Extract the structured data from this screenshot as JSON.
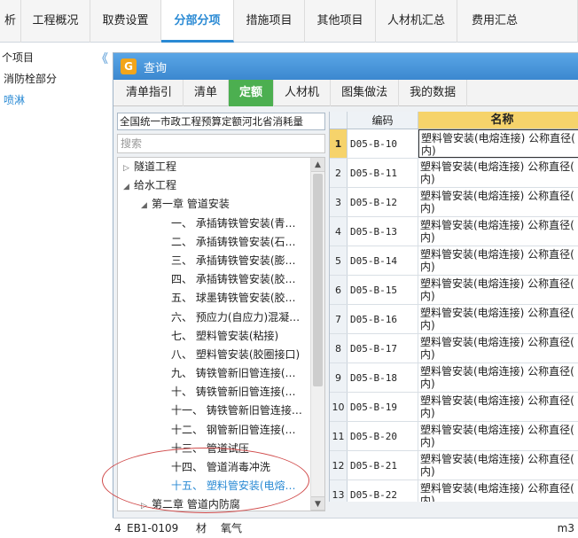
{
  "topbar": {
    "tabs": [
      {
        "label": "析",
        "active": false
      },
      {
        "label": "工程概况",
        "active": false
      },
      {
        "label": "取费设置",
        "active": false
      },
      {
        "label": "分部分项",
        "active": true
      },
      {
        "label": "措施项目",
        "active": false
      },
      {
        "label": "其他项目",
        "active": false
      },
      {
        "label": "人材机汇总",
        "active": false
      },
      {
        "label": "费用汇总",
        "active": false
      }
    ]
  },
  "left_panel": {
    "rows": [
      "个项目",
      "消防栓部分",
      "喷淋"
    ],
    "collapse_icon": "double-chevron-left"
  },
  "dialog": {
    "title": "查询",
    "tabs": [
      "清单指引",
      "清单",
      "定额",
      "人材机",
      "图集做法",
      "我的数据"
    ],
    "active_tab": "定额",
    "db_select": "全国统一市政工程预算定额河北省消耗量",
    "search_placeholder": "搜索",
    "tree": [
      {
        "label": "隧道工程",
        "level": 0,
        "arrow": "▷"
      },
      {
        "label": "给水工程",
        "level": 0,
        "arrow": "◢"
      },
      {
        "label": "第一章  管道安装",
        "level": 1,
        "arrow": "◢"
      },
      {
        "label": "一、  承插铸铁管安装(青…",
        "level": 2,
        "arrow": ""
      },
      {
        "label": "二、  承插铸铁管安装(石…",
        "level": 2,
        "arrow": ""
      },
      {
        "label": "三、  承插铸铁管安装(膨…",
        "level": 2,
        "arrow": ""
      },
      {
        "label": "四、  承插铸铁管安装(胶…",
        "level": 2,
        "arrow": ""
      },
      {
        "label": "五、  球墨铸铁管安装(胶…",
        "level": 2,
        "arrow": ""
      },
      {
        "label": "六、  预应力(自应力)混凝…",
        "level": 2,
        "arrow": ""
      },
      {
        "label": "七、  塑料管安装(粘接)",
        "level": 2,
        "arrow": ""
      },
      {
        "label": "八、  塑料管安装(胶圈接口)",
        "level": 2,
        "arrow": ""
      },
      {
        "label": "九、  铸铁管新旧管连接(…",
        "level": 2,
        "arrow": ""
      },
      {
        "label": "十、  铸铁管新旧管连接(…",
        "level": 2,
        "arrow": ""
      },
      {
        "label": "十一、  铸铁管新旧管连接…",
        "level": 2,
        "arrow": ""
      },
      {
        "label": "十二、  钢管新旧管连接(…",
        "level": 2,
        "arrow": ""
      },
      {
        "label": "十三、  管道试压",
        "level": 2,
        "arrow": ""
      },
      {
        "label": "十四、  管道消毒冲洗",
        "level": 2,
        "arrow": ""
      },
      {
        "label": "十五、  塑料管安装(电熔…",
        "level": 2,
        "arrow": "",
        "highlight": true
      },
      {
        "label": "第二章  管道内防腐",
        "level": 1,
        "arrow": "▷"
      }
    ],
    "grid": {
      "headers": {
        "code": "编码",
        "name": "名称"
      },
      "rows": [
        {
          "n": "1",
          "code": "D05-B-10",
          "l1": "塑料管安装(电熔连接) 公称直径(",
          "l2": "内)",
          "selected": true
        },
        {
          "n": "2",
          "code": "D05-B-11",
          "l1": "塑料管安装(电熔连接) 公称直径(",
          "l2": "内)"
        },
        {
          "n": "3",
          "code": "D05-B-12",
          "l1": "塑料管安装(电熔连接) 公称直径(",
          "l2": "内)"
        },
        {
          "n": "4",
          "code": "D05-B-13",
          "l1": "塑料管安装(电熔连接) 公称直径(",
          "l2": "内)"
        },
        {
          "n": "5",
          "code": "D05-B-14",
          "l1": "塑料管安装(电熔连接) 公称直径(",
          "l2": "内)"
        },
        {
          "n": "6",
          "code": "D05-B-15",
          "l1": "塑料管安装(电熔连接) 公称直径(",
          "l2": "内)"
        },
        {
          "n": "7",
          "code": "D05-B-16",
          "l1": "塑料管安装(电熔连接) 公称直径(",
          "l2": "内)"
        },
        {
          "n": "8",
          "code": "D05-B-17",
          "l1": "塑料管安装(电熔连接) 公称直径(",
          "l2": "内)"
        },
        {
          "n": "9",
          "code": "D05-B-18",
          "l1": "塑料管安装(电熔连接) 公称直径(",
          "l2": "内)"
        },
        {
          "n": "10",
          "code": "D05-B-19",
          "l1": "塑料管安装(电熔连接) 公称直径(",
          "l2": "内)"
        },
        {
          "n": "11",
          "code": "D05-B-20",
          "l1": "塑料管安装(电熔连接) 公称直径(",
          "l2": "内)"
        },
        {
          "n": "12",
          "code": "D05-B-21",
          "l1": "塑料管安装(电熔连接) 公称直径(",
          "l2": "内)"
        },
        {
          "n": "13",
          "code": "D05-B-22",
          "l1": "塑料管安装(电熔连接) 公称直径(",
          "l2": "内)"
        }
      ]
    }
  },
  "bottom_row": {
    "index": "4",
    "code": "EB1-0109",
    "type": "材",
    "name": "氧气",
    "unit": "m3"
  },
  "colors": {
    "accent": "#2a8ad4",
    "active_tab_green": "#4caf50",
    "header_yellow": "#f6d36b",
    "annotation_red": "#d04a4a"
  }
}
